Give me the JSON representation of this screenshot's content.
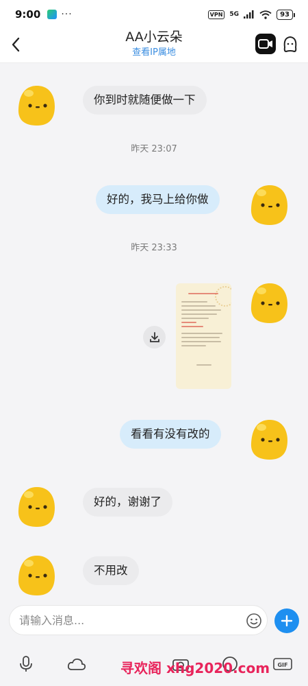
{
  "status_bar": {
    "time": "9:00",
    "dots": "···",
    "vpn": "VPN",
    "network": "5G",
    "battery": "93"
  },
  "header": {
    "title": "AA小云朵",
    "ip_link": "查看IP属地"
  },
  "messages": [
    {
      "side": "in",
      "text": "你到时就随便做一下"
    },
    {
      "side": "time",
      "text": "昨天 23:07"
    },
    {
      "side": "out",
      "text": "好的，我马上给你做"
    },
    {
      "side": "time",
      "text": "昨天 23:33"
    },
    {
      "side": "out",
      "type": "image"
    },
    {
      "side": "out",
      "text": "看看有没有改的"
    },
    {
      "side": "in",
      "text": "好的，谢谢了"
    },
    {
      "side": "in",
      "text": "不用改"
    }
  ],
  "input": {
    "placeholder": "请输入消息..."
  },
  "toolbar": {
    "icons": [
      "mic-icon",
      "cloud-icon",
      "image-icon",
      "camera-icon",
      "compass-icon",
      "gif-icon"
    ]
  },
  "watermark": "寻欢阁 xhg2020.com",
  "colors": {
    "accent": "#1e8ff0",
    "out_bubble": "#d7ecfb",
    "in_bubble": "#ebebed",
    "avatar": "#f7c21a"
  }
}
